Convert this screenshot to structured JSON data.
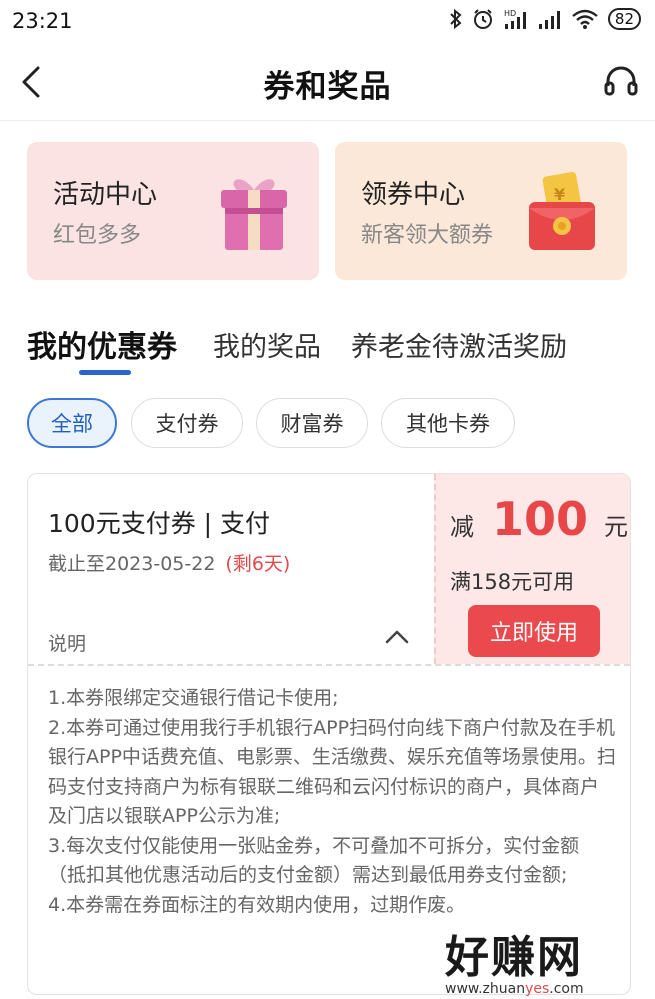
{
  "status_bar": {
    "time": "23:21",
    "battery": "82",
    "network_tag": "HD"
  },
  "header": {
    "title": "券和奖品"
  },
  "cards": [
    {
      "title": "活动中心",
      "subtitle": "红包多多",
      "icon": "gift-box-icon"
    },
    {
      "title": "领券中心",
      "subtitle": "新客领大额券",
      "icon": "red-envelope-icon"
    }
  ],
  "tabs": [
    {
      "label": "我的优惠券",
      "active": true
    },
    {
      "label": "我的奖品",
      "active": false
    },
    {
      "label": "养老金待激活奖励",
      "active": false
    }
  ],
  "filters": [
    {
      "label": "全部",
      "active": true
    },
    {
      "label": "支付券",
      "active": false
    },
    {
      "label": "财富券",
      "active": false
    },
    {
      "label": "其他卡券",
      "active": false
    }
  ],
  "coupon": {
    "name": "100元支付券 | 支付",
    "expiry": "截止至2023-05-22",
    "remaining": "(剩6天)",
    "explain_label": "说明",
    "discount_prefix": "减",
    "discount_amount": "100",
    "discount_unit": "元",
    "threshold": "满158元可用",
    "use_button": "立即使用",
    "details": [
      "1.本券限绑定交通银行借记卡使用;",
      "2.本券可通过使用我行手机银行APP扫码付向线下商户付款及在手机银行APP中话费充值、电影票、生活缴费、娱乐充值等场景使用。扫码支付支持商户为标有银联二维码和云闪付标识的商户，具体商户及门店以银联APP公示为准;",
      "3.每次支付仅能使用一张贴金券，不可叠加不可拆分，实付金额（抵扣其他优惠活动后的支付金额）需达到最低用券支付金额;",
      "4.本券需在券面标注的有效期内使用，过期作废。"
    ]
  },
  "watermark": {
    "text": "好赚网",
    "url_prefix": "www.zhuan",
    "url_highlight": "yes",
    "url_suffix": ".com"
  },
  "colors": {
    "accent_blue": "#2a66c9",
    "coupon_red": "#e8474a",
    "card_pink": "#fbe3e3",
    "card_peach": "#fce8d9"
  }
}
